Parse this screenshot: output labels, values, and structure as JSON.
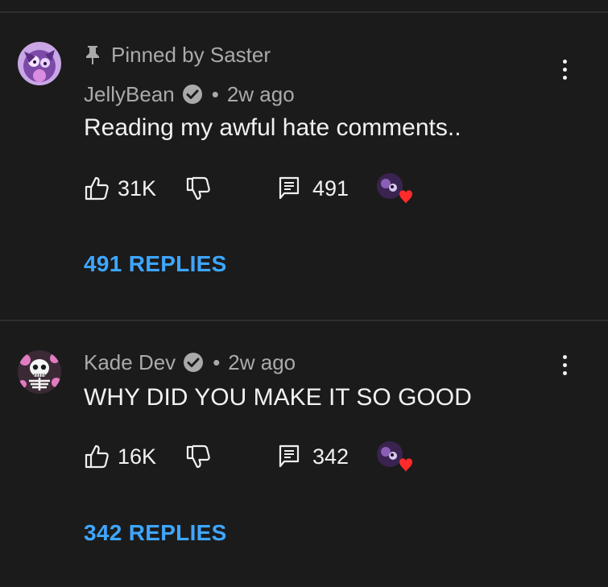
{
  "comments": [
    {
      "pinned_label": "Pinned by Saster",
      "author": "JellyBean",
      "separator": "•",
      "time": "2w ago",
      "text": "Reading my awful hate comments..",
      "likes": "31K",
      "reply_count": "491",
      "replies_link": "491 REPLIES",
      "creator_hearted": true
    },
    {
      "author": "Kade Dev",
      "separator": "•",
      "time": "2w ago",
      "text": "WHY DID YOU MAKE IT SO GOOD",
      "likes": "16K",
      "reply_count": "342",
      "replies_link": "342 REPLIES",
      "creator_hearted": true
    }
  ],
  "colors": {
    "background": "#1b1b1b",
    "text_primary": "#f1f1f1",
    "text_secondary": "#aaaaaa",
    "link": "#3ea6ff",
    "heart": "#ff2b2b"
  },
  "icons": [
    "pin-icon",
    "verified-check-icon",
    "thumbs-up-icon",
    "thumbs-down-icon",
    "comment-icon",
    "creator-heart-icon",
    "more-vertical-icon"
  ]
}
